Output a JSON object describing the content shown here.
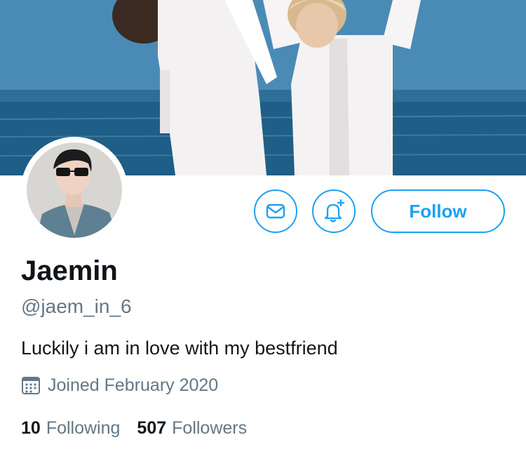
{
  "profile": {
    "display_name": "Jaemin",
    "handle": "@jaem_in_6",
    "bio": "Luckily i am in love with my bestfriend",
    "joined": "Joined February 2020"
  },
  "actions": {
    "follow_label": "Follow",
    "message_icon": "envelope-icon",
    "notify_icon": "bell-plus-icon"
  },
  "stats": {
    "following_count": "10",
    "following_label": "Following",
    "followers_count": "507",
    "followers_label": "Followers"
  },
  "colors": {
    "accent": "#1da1f2",
    "text_primary": "#14171a",
    "text_secondary": "#657786"
  }
}
